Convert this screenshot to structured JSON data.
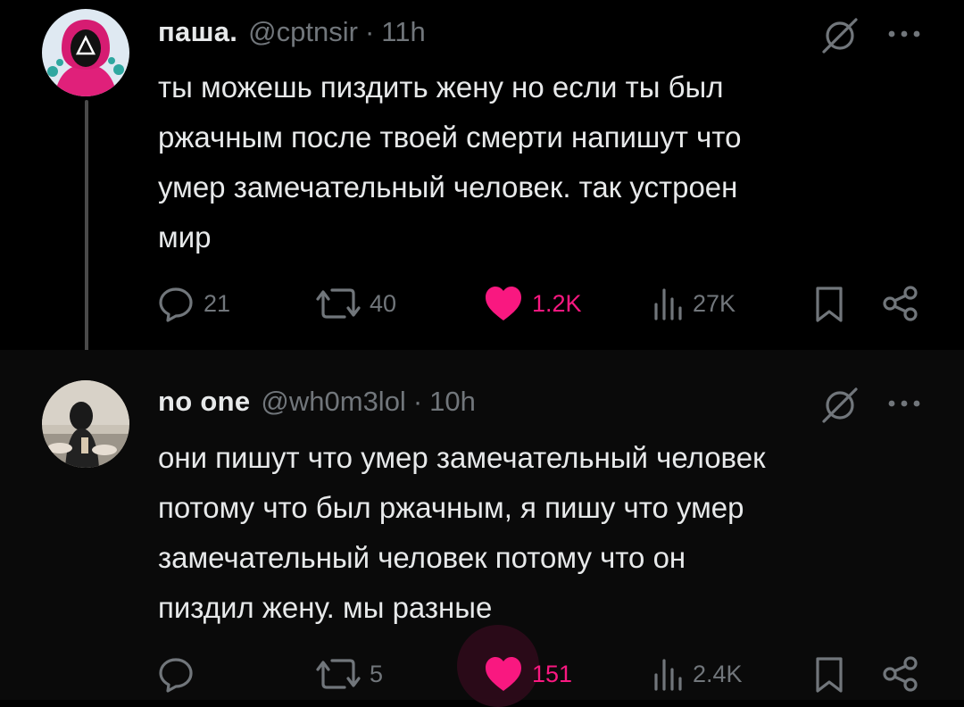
{
  "posts": [
    {
      "author": {
        "name": "паша.",
        "handle": "@cptnsir",
        "separator": "·",
        "time": "11h"
      },
      "text_lines": [
        "ты можешь пиздить жену но если ты был",
        "ржачным после твоей смерти напишут что",
        "умер замечательный человек. так устроен",
        "мир"
      ],
      "actions": {
        "replies": "21",
        "reposts": "40",
        "likes": "1.2K",
        "views": "27K"
      },
      "liked": true,
      "avatar_icon": "squid-game-guard-avatar"
    },
    {
      "author": {
        "name": "no one",
        "handle": "@wh0m3lol",
        "separator": "·",
        "time": "10h"
      },
      "text_lines": [
        "они пишут что умер замечательный человек",
        "потому что был ржачным, я пишу что умер",
        "замечательный человек потому что он",
        "пиздил жену. мы разные"
      ],
      "actions": {
        "replies": "",
        "reposts": "5",
        "likes": "151",
        "views": "2.4K"
      },
      "liked": true,
      "avatar_icon": "person-photo-avatar"
    }
  ],
  "colors": {
    "background": "#000000",
    "text": "#e7e9ea",
    "muted": "#71767b",
    "like": "#f91880"
  },
  "icons": [
    "reply-icon",
    "repost-icon",
    "like-icon",
    "views-icon",
    "bookmark-icon",
    "share-icon",
    "grok-icon",
    "more-icon"
  ]
}
